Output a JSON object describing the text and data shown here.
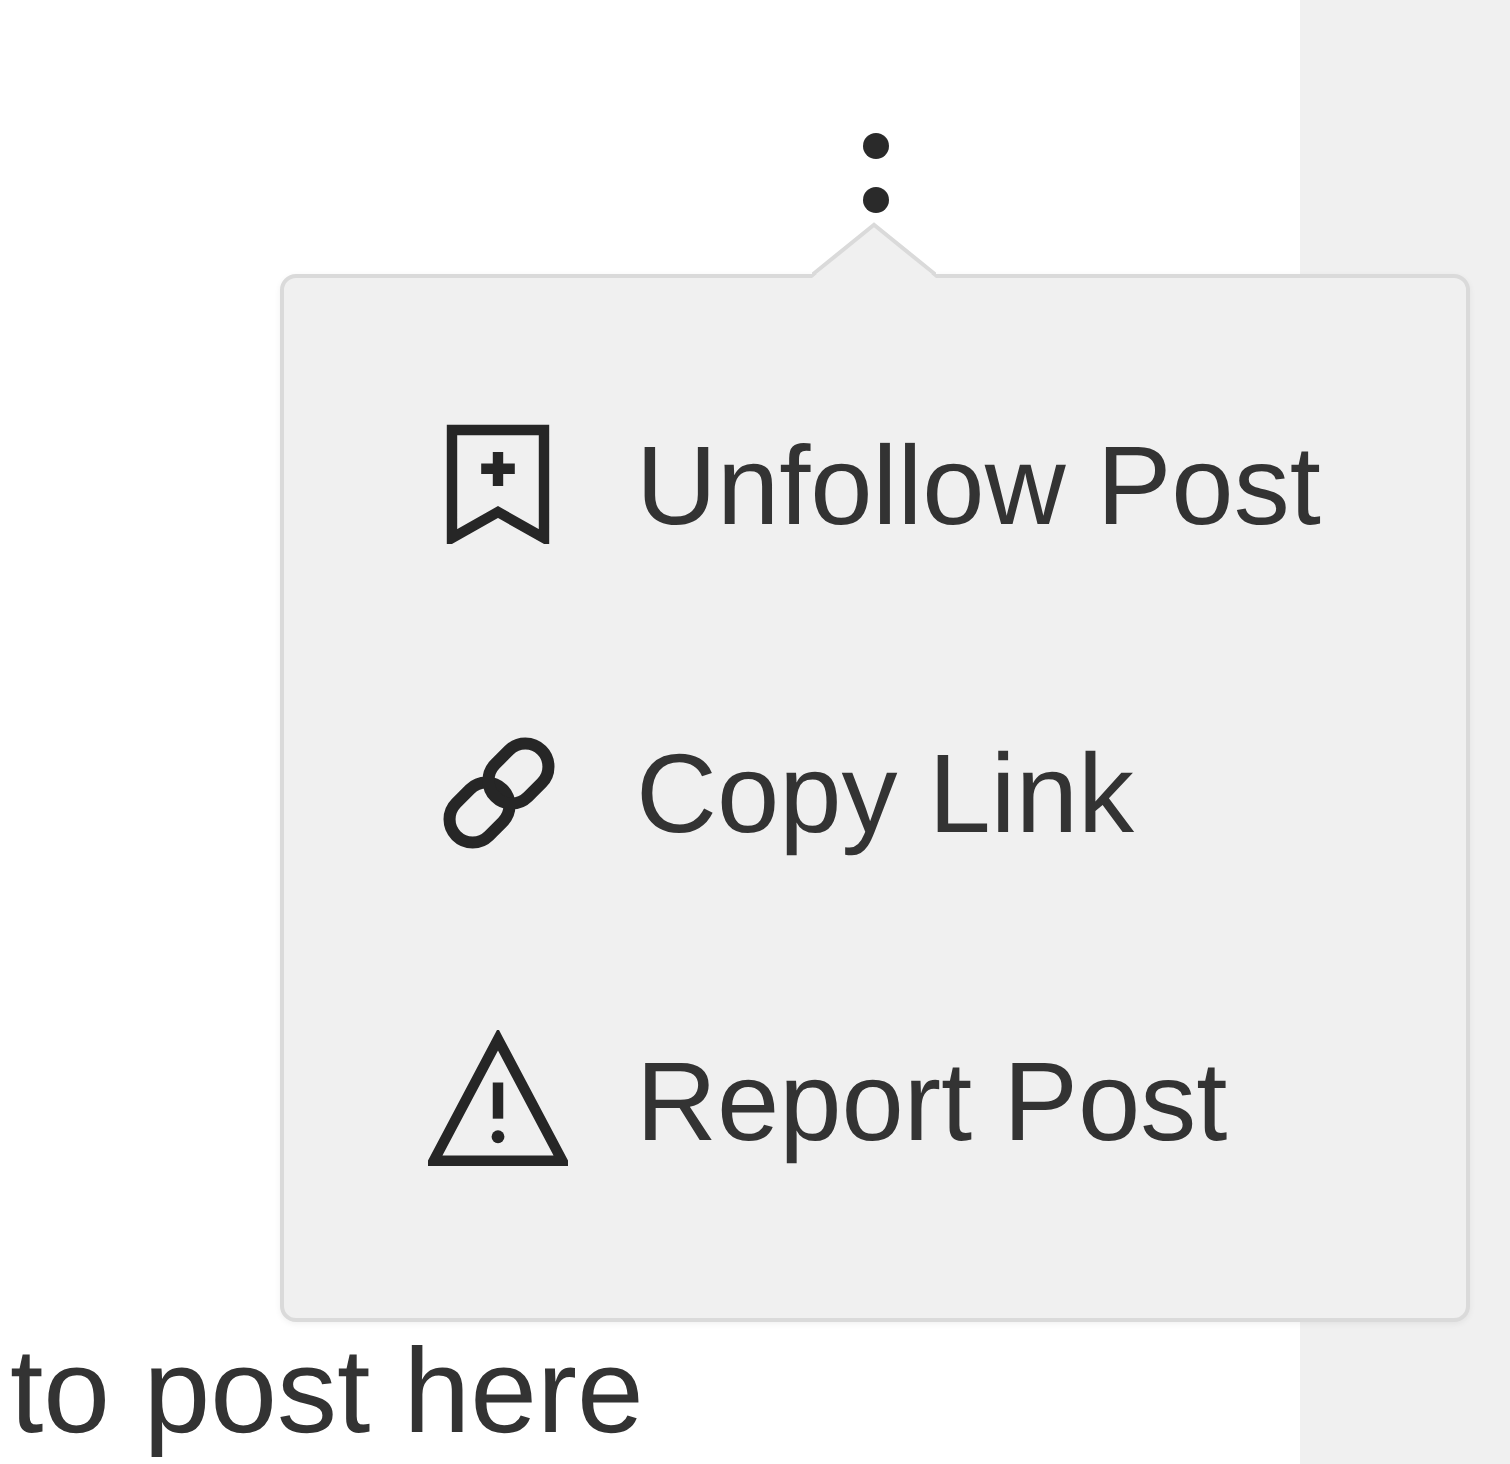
{
  "more_menu": {
    "expanded": true,
    "items": [
      {
        "kind": "unfollow",
        "label": "Unfollow Post"
      },
      {
        "kind": "link",
        "label": "Copy Link"
      },
      {
        "kind": "report",
        "label": "Report Post"
      }
    ]
  },
  "post_text": "to post here"
}
